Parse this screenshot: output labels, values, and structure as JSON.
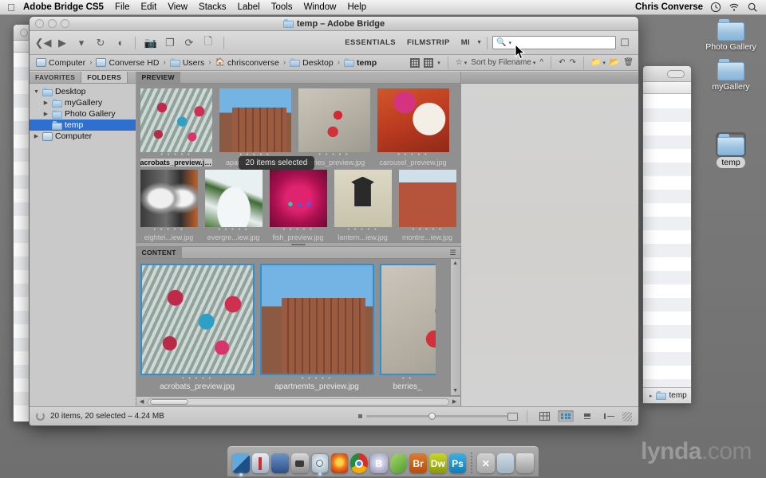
{
  "menubar": {
    "apple": "apple-logo",
    "app_name": "Adobe Bridge CS5",
    "items": [
      "File",
      "Edit",
      "View",
      "Stacks",
      "Label",
      "Tools",
      "Window",
      "Help"
    ],
    "user": "Chris Converse",
    "icons": [
      "time-machine-icon",
      "wifi-icon",
      "spotlight-search-icon"
    ]
  },
  "desktop": {
    "icons": [
      {
        "label": "Photo Gallery",
        "selected": false
      },
      {
        "label": "myGallery",
        "selected": false
      },
      {
        "label": "temp",
        "selected": true
      }
    ]
  },
  "background_window": {
    "path_label": "temp"
  },
  "bridge": {
    "title": "temp – Adobe Bridge",
    "traffic_lights": [
      "close-button",
      "minimize-button",
      "zoom-button"
    ],
    "toolbar": {
      "icons": [
        "back-arrow-icon",
        "forward-arrow-icon",
        "dropdown-caret-icon",
        "rotate-icon",
        "boomerang-icon",
        "get-photos-from-camera-icon",
        "copy-icon",
        "refresh-icon",
        "new-file-icon"
      ],
      "workspaces": [
        "ESSENTIALS",
        "FILMSTRIP",
        "MI"
      ],
      "search_placeholder": "",
      "search_value": "",
      "compact_mode_label": "switch-to-compact-mode"
    },
    "breadcrumb": [
      {
        "label": "Computer",
        "icon": "computer-icon"
      },
      {
        "label": "Converse HD",
        "icon": "harddrive-icon"
      },
      {
        "label": "Users",
        "icon": "users-folder-icon"
      },
      {
        "label": "chrisconverse",
        "icon": "home-icon"
      },
      {
        "label": "Desktop",
        "icon": "desktop-folder-icon"
      },
      {
        "label": "temp",
        "icon": "folder-icon"
      }
    ],
    "pathbar_right": {
      "sort_label": "Sort by Filename",
      "buttons": [
        "thumbnail-view-icon",
        "details-view-icon",
        "filter-star-icon",
        "sort-ascending-icon",
        "rotate-counterclockwise-icon",
        "rotate-clockwise-icon",
        "new-folder-icon",
        "open-folder-icon",
        "delete-icon"
      ]
    },
    "left_panel": {
      "tabs": [
        {
          "label": "FAVORITES",
          "active": false
        },
        {
          "label": "FOLDERS",
          "active": true
        }
      ],
      "tree": [
        {
          "label": "Desktop",
          "depth": 0,
          "icon": "desktop-folder-icon",
          "twisty": "down",
          "selected": false
        },
        {
          "label": "myGallery",
          "depth": 1,
          "icon": "folder-icon",
          "twisty": "right",
          "selected": false
        },
        {
          "label": "Photo Gallery",
          "depth": 1,
          "icon": "folder-icon",
          "twisty": "right",
          "selected": false
        },
        {
          "label": "temp",
          "depth": 1,
          "icon": "folder-icon",
          "twisty": "none",
          "selected": true
        },
        {
          "label": "Computer",
          "depth": 0,
          "icon": "computer-icon",
          "twisty": "right",
          "selected": false
        }
      ]
    },
    "preview_panel": {
      "tab": "PREVIEW",
      "tooltip": "20 items selected",
      "row1": [
        {
          "name": "acrobats_preview.jpg",
          "art": "ph-acrobats",
          "active": true
        },
        {
          "name": "apartnem...iew.jpg",
          "art": "ph-apart",
          "active": false
        },
        {
          "name": "berries_preview.jpg",
          "art": "ph-berries",
          "active": false
        },
        {
          "name": "carousel_preview.jpg",
          "art": "ph-carousel",
          "active": false
        }
      ],
      "row2": [
        {
          "name": "eightei...iew.jpg",
          "art": "ph-eighteen"
        },
        {
          "name": "evergre...iew.jpg",
          "art": "ph-evergreen"
        },
        {
          "name": "fish_preview.jpg",
          "art": "ph-fish"
        },
        {
          "name": "lantern...iew.jpg",
          "art": "ph-lantern"
        },
        {
          "name": "montre...iew.jpg",
          "art": "ph-montreal"
        }
      ]
    },
    "content_panel": {
      "tab": "CONTENT",
      "items": [
        {
          "name": "acrobats_preview.jpg",
          "art": "ph-acrobats",
          "selected": true
        },
        {
          "name": "apartnemts_preview.jpg",
          "art": "ph-apart",
          "selected": true
        },
        {
          "name": "berries_",
          "art": "ph-berries",
          "selected": true
        }
      ]
    },
    "status": {
      "text": "20 items, 20 selected – 4.24 MB",
      "view_buttons": [
        "list-view-icon",
        "grid-view-icon",
        "details-view-icon",
        "list-detail-icon"
      ]
    }
  },
  "dock": {
    "items": [
      {
        "name": "finder",
        "label": "",
        "color": "#3b7fc4"
      },
      {
        "name": "iphoto",
        "label": "",
        "color": "#cfd6dd"
      },
      {
        "name": "preview",
        "label": "",
        "color": "#4d6fa8"
      },
      {
        "name": "imovie",
        "label": "",
        "color": "#5a5a5a"
      },
      {
        "name": "safari",
        "label": "",
        "color": "#c9d4dc"
      },
      {
        "name": "firefox",
        "label": "",
        "color": "#e8711a"
      },
      {
        "name": "chrome",
        "label": "",
        "color": "#3a8f3a"
      },
      {
        "name": "bbedit",
        "label": "",
        "color": "#8f8fb8"
      },
      {
        "name": "coda",
        "label": "",
        "color": "#7cc242"
      },
      {
        "name": "adobe-bridge",
        "label": "Br",
        "color": "#c9621f"
      },
      {
        "name": "adobe-dreamweaver",
        "label": "Dw",
        "color": "#a9b815"
      },
      {
        "name": "adobe-photoshop",
        "label": "Ps",
        "color": "#1f9ad6"
      },
      {
        "name": "separator",
        "label": "",
        "color": ""
      },
      {
        "name": "utility",
        "label": "",
        "color": "#b9b9b9"
      },
      {
        "name": "documents-folder",
        "label": "",
        "color": "#b7c4cf"
      },
      {
        "name": "trash",
        "label": "",
        "color": "#bcbcbc"
      }
    ]
  },
  "watermark": {
    "bold": "lynda",
    "light": ".com"
  }
}
